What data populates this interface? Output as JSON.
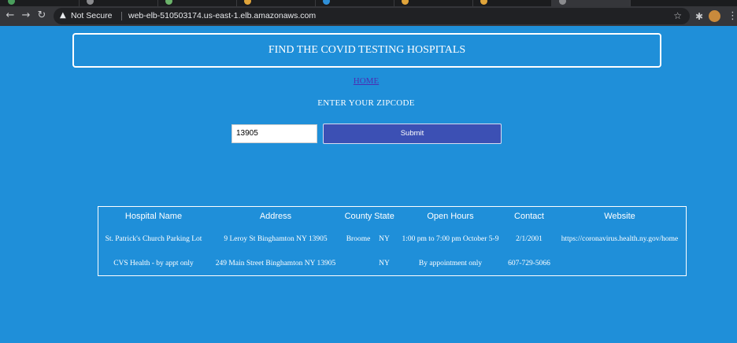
{
  "browser": {
    "security_label": "Not Secure",
    "url": "web-elb-510503174.us-east-1.elb.amazonaws.com"
  },
  "page": {
    "title": "FIND THE COVID TESTING HOSPITALS",
    "home_link": "HOME",
    "zip_label": "ENTER YOUR ZIPCODE",
    "zip_value": "13905",
    "submit_label": "Submit"
  },
  "table": {
    "headers": [
      "Hospital Name",
      "Address",
      "County",
      "State",
      "Open Hours",
      "Contact",
      "Website"
    ],
    "rows": [
      [
        "St. Patrick's Church Parking Lot",
        "9 Leroy St Binghamton NY 13905",
        "Broome",
        "NY",
        "1:00 pm to 7:00 pm October 5-9",
        "2/1/2001",
        "https://coronavirus.health.ny.gov/home"
      ],
      [
        "CVS Health - by appt only",
        "249 Main Street Binghamton NY 13905",
        "",
        "NY",
        "By appointment only",
        "607-729-5066",
        ""
      ]
    ]
  },
  "colors": {
    "page_background": "#1f8fd9",
    "submit_button": "#3c50b4",
    "home_link": "#4b2fb3"
  },
  "icons": [
    "back-arrow-icon",
    "forward-arrow-icon",
    "reload-icon",
    "warning-icon",
    "star-icon",
    "extensions-puzzle-icon",
    "profile-avatar-icon",
    "menu-dots-icon"
  ]
}
